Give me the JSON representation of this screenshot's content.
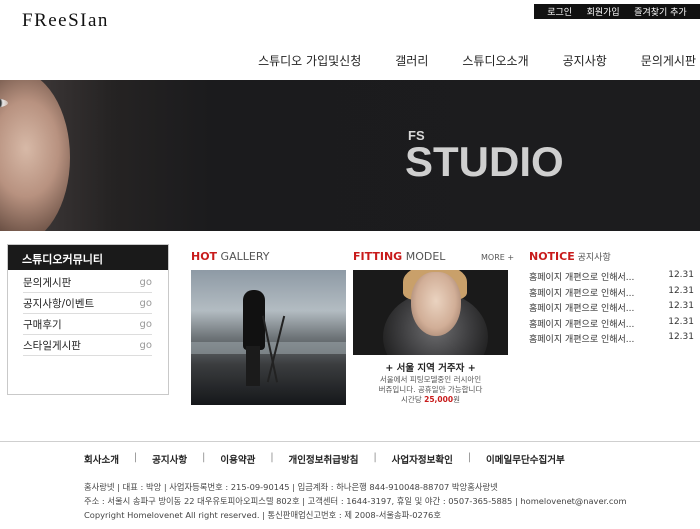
{
  "header": {
    "logo": "FReeSIan",
    "util": [
      "로그인",
      "회원가입",
      "즐겨찾기 추가"
    ],
    "nav": [
      "스튜디오 가입및신청",
      "갤러리",
      "스튜디오소개",
      "공지사항",
      "문의게시판"
    ]
  },
  "banner": {
    "small": "FS",
    "big": "STUDIO"
  },
  "community": {
    "title": "스튜디오커뮤니티",
    "items": [
      {
        "label": "문의게시판",
        "go": "go"
      },
      {
        "label": "공지사항/이벤트",
        "go": "go"
      },
      {
        "label": "구매후기",
        "go": "go"
      },
      {
        "label": "스타일게시판",
        "go": "go"
      }
    ]
  },
  "gallery": {
    "title_red": "HOT",
    "title_gray": " GALLERY"
  },
  "fitting": {
    "title_red": "FITTING",
    "title_gray": " MODEL",
    "more": "MORE +",
    "heading": "+ 서울 지역 거주자 +",
    "desc1": "서울에서 피팅모델중인 러시아인",
    "desc2": "버쥬입니다.  공휴일만 가능합니다",
    "price_prefix": "시간당 ",
    "price": "25,000",
    "price_suffix": "원"
  },
  "notice": {
    "title_red": "NOTICE",
    "title_gray": " 공지사항",
    "items": [
      {
        "text": "홈페이지 개편으로 인해서...",
        "date": "12.31"
      },
      {
        "text": "홈페이지 개편으로 인해서...",
        "date": "12.31"
      },
      {
        "text": "홈페이지 개편으로 인해서...",
        "date": "12.31"
      },
      {
        "text": "홈페이지 개편으로 인해서...",
        "date": "12.31"
      },
      {
        "text": "홈페이지 개편으로 인해서...",
        "date": "12.31"
      }
    ]
  },
  "footer": {
    "nav": [
      "회사소개",
      "공지사항",
      "이용약관",
      "개인정보취급방침",
      "사업자정보확인",
      "이메일무단수집거부"
    ],
    "line1": "홈사랑넷  |  대표 : 박앙  |  사업자등록번호 : 215-09-90145  |  입금계좌 : 하나은행 844-910048-88707 박앙홈사랑넷",
    "line2": "주소 : 서울시 송파구 방이동 22 대우유토피아오피스텔 802호  |  고객센터 : 1644-3197, 휴일 및 야간 : 0507-365-5885  |  homelovenet@naver.com",
    "line3": "Copyright Homelovenet All right reserved.   |   통신판매업신고번호 : 제 2008-서울송파-0276호"
  }
}
